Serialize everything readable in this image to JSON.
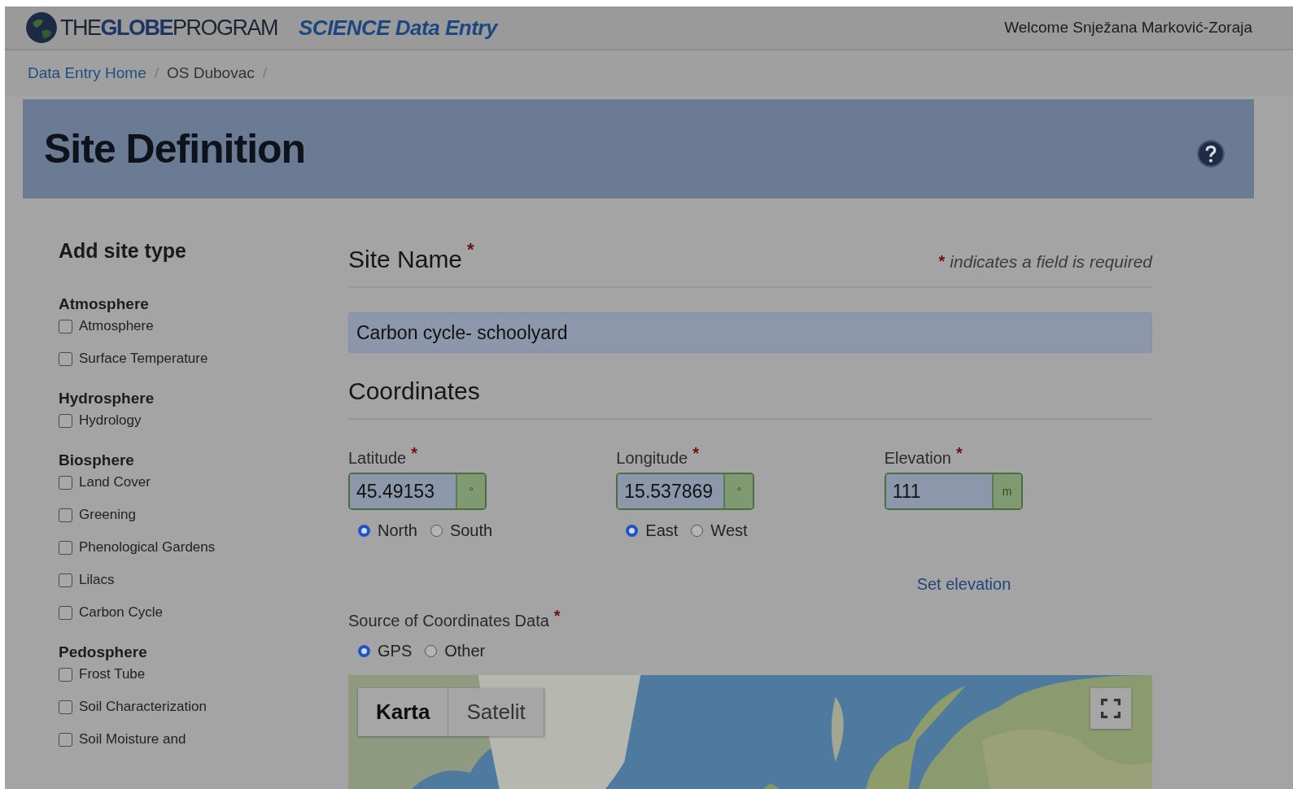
{
  "header": {
    "logo_text": "THE**GLOBE**PROGRAM",
    "app_title": "SCIENCE Data Entry",
    "welcome": "Welcome Snježana Marković-Zoraja"
  },
  "breadcrumb": {
    "separator": "/",
    "items": [
      {
        "label": "Data Entry Home",
        "kind": "link"
      },
      {
        "label": "OS Dubovac",
        "kind": "text"
      }
    ]
  },
  "page_title": "Site Definition",
  "sidebar": {
    "title": "Add site type",
    "groups": [
      {
        "title": "Atmosphere",
        "items": [
          {
            "label": "Atmosphere",
            "checked": false
          },
          {
            "label": "Surface Temperature",
            "checked": false
          }
        ]
      },
      {
        "title": "Hydrosphere",
        "items": [
          {
            "label": "Hydrology",
            "checked": false
          }
        ]
      },
      {
        "title": "Biosphere",
        "items": [
          {
            "label": "Land Cover",
            "checked": false
          },
          {
            "label": "Greening",
            "checked": false
          },
          {
            "label": "Phenological Gardens",
            "checked": false
          },
          {
            "label": "Lilacs",
            "checked": false
          },
          {
            "label": "Carbon Cycle",
            "checked": false
          }
        ]
      },
      {
        "title": "Pedosphere",
        "items": [
          {
            "label": "Frost Tube",
            "checked": false
          },
          {
            "label": "Soil Characterization",
            "checked": false
          },
          {
            "label": "Soil Moisture and",
            "checked": false
          }
        ]
      }
    ]
  },
  "form": {
    "site_name": {
      "label": "Site Name",
      "required_mark": "*",
      "value": "Carbon cycle- schoolyard"
    },
    "required_note": {
      "mark": "*",
      "text": "indicates a field is required"
    },
    "coordinates_heading": "Coordinates",
    "fields": [
      {
        "label": "Latitude",
        "required_mark": "*",
        "value": "45.49153",
        "unit": "°",
        "options": [
          {
            "label": "North",
            "selected": true
          },
          {
            "label": "South",
            "selected": false
          }
        ]
      },
      {
        "label": "Longitude",
        "required_mark": "*",
        "value": "15.537869",
        "unit": "°",
        "options": [
          {
            "label": "East",
            "selected": true
          },
          {
            "label": "West",
            "selected": false
          }
        ]
      },
      {
        "label": "Elevation",
        "required_mark": "*",
        "value": "111",
        "unit": "m",
        "link": "Set elevation"
      }
    ],
    "source": {
      "label": "Source of Coordinates Data",
      "required_mark": "*",
      "options": [
        {
          "label": "GPS",
          "selected": true
        },
        {
          "label": "Other",
          "selected": false
        }
      ]
    }
  },
  "map": {
    "kind": "picture",
    "map_types": [
      {
        "label": "Karta",
        "selected": true
      },
      {
        "label": "Satelit",
        "selected": false
      }
    ]
  }
}
